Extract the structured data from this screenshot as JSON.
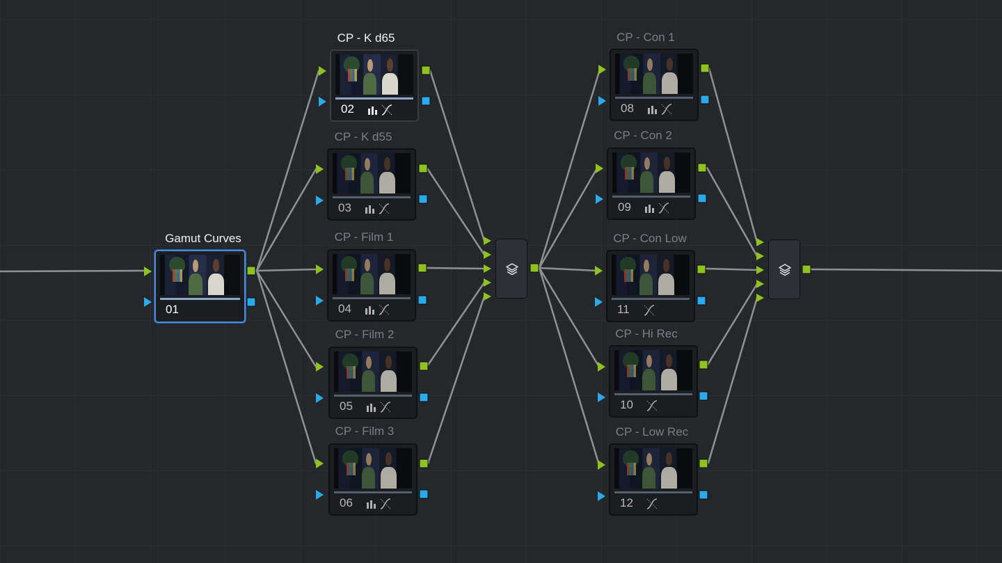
{
  "colors": {
    "background": "#25272b",
    "wire": "#8f9195",
    "rgb_port": "#8dc21f",
    "key_port": "#29aaeb",
    "selected_border": "#4a8ad8",
    "label_active": "#f2f2f2",
    "label_inactive": "#7c7f85"
  },
  "nodes": [
    {
      "id": "01",
      "label": "Gamut Curves",
      "state": "selected",
      "tools": [
        "curves-icon-hidden"
      ]
    },
    {
      "id": "02",
      "label": "CP - K d65",
      "state": "active",
      "tools": [
        "bars-icon",
        "curves-icon"
      ]
    },
    {
      "id": "03",
      "label": "CP - K d55",
      "state": "dim",
      "tools": [
        "bars-icon",
        "curves-icon"
      ]
    },
    {
      "id": "04",
      "label": "CP - Film 1",
      "state": "dim",
      "tools": [
        "bars-icon",
        "curves-icon"
      ]
    },
    {
      "id": "05",
      "label": "CP - Film 2",
      "state": "dim",
      "tools": [
        "bars-icon",
        "curves-icon"
      ]
    },
    {
      "id": "06",
      "label": "CP - Film 3",
      "state": "dim",
      "tools": [
        "bars-icon",
        "curves-icon"
      ]
    },
    {
      "id": "08",
      "label": "CP - Con 1",
      "state": "dim",
      "tools": [
        "bars-icon",
        "curves-icon"
      ]
    },
    {
      "id": "09",
      "label": "CP - Con 2",
      "state": "dim",
      "tools": [
        "bars-icon",
        "curves-icon"
      ]
    },
    {
      "id": "11",
      "label": "CP - Con Low",
      "state": "dim",
      "tools": [
        "curves-icon"
      ]
    },
    {
      "id": "10",
      "label": "CP - Hi Rec",
      "state": "dim",
      "tools": [
        "curves-icon"
      ]
    },
    {
      "id": "12",
      "label": "CP - Low Rec",
      "state": "dim",
      "tools": [
        "curves-icon"
      ]
    }
  ],
  "mixers": [
    {
      "id": "layer-mixer-1",
      "icon": "layers-icon"
    },
    {
      "id": "layer-mixer-2",
      "icon": "layers-icon"
    }
  ]
}
